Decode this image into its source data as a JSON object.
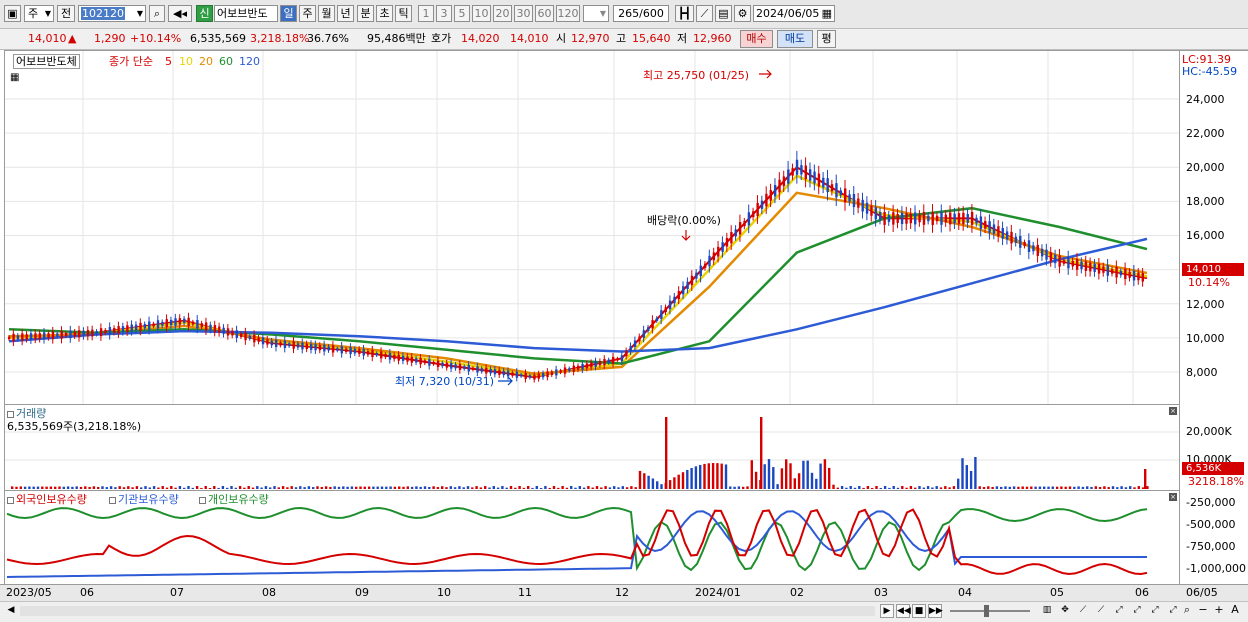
{
  "toolbar": {
    "market": "주",
    "period_prefix": "전",
    "code": "102120",
    "new_badge": "신",
    "stock_name": "어보브반도",
    "period_buttons": [
      "일",
      "주",
      "월",
      "년",
      "분",
      "초",
      "틱"
    ],
    "minute_buttons": [
      "1",
      "3",
      "5",
      "10",
      "20",
      "30",
      "60",
      "120"
    ],
    "count_value": "265",
    "count_total": "/600",
    "date": "2024/06/05"
  },
  "infobar": {
    "price": "14,010",
    "up_arrow": "▲",
    "change": "1,290",
    "change_pct": "+10.14%",
    "volume": "6,535,569",
    "volume_pct": "3,218.18%",
    "turnover": "36.76%",
    "amount": "95,486백만",
    "ask_label": "호가",
    "ask": "14,020",
    "bid": "14,010",
    "open_label": "시",
    "open": "12,970",
    "high_label": "고",
    "high": "15,640",
    "low_label": "저",
    "low": "12,960",
    "buy_label": "매수",
    "sell_label": "매도",
    "eval_label": "평"
  },
  "price_panel": {
    "title": "어보브반도체",
    "legend_prefix": "종가 단순",
    "ma_labels": [
      "5",
      "10",
      "20",
      "60",
      "120"
    ],
    "ma_colors": [
      "#d40000",
      "#e8d400",
      "#e48a00",
      "#1f8f2e",
      "#2d5bd6"
    ],
    "high_annotation": "최고 25,750 (01/25)",
    "low_annotation": "최저 7,320 (10/31)",
    "dividend_annotation": "배당락(0.00%)"
  },
  "price_axis": {
    "lc": "LC:91.39",
    "hc": "HC:-45.59",
    "labels": [
      "24,000",
      "22,000",
      "20,000",
      "18,000",
      "16,000",
      "14,000",
      "12,000",
      "10,000",
      "8,000"
    ],
    "current_price": "14,010",
    "current_pct": "10.14%"
  },
  "volume_panel": {
    "title": "거래량",
    "value": "6,535,569주(3,218.18%)",
    "labels": [
      "20,000K",
      "10,000K"
    ],
    "current": "6,536K",
    "current_pct": "3218.18%"
  },
  "holdings_panel": {
    "legend": [
      "외국인보유수량",
      "기관보유수량",
      "개인보유수량"
    ],
    "legend_colors": [
      "#d40000",
      "#2d5bd6",
      "#1f8f2e"
    ],
    "labels": [
      "-250,000",
      "-500,000",
      "-750,000",
      "-1,000,000"
    ]
  },
  "dates": [
    "2023/05",
    "06",
    "07",
    "08",
    "09",
    "10",
    "11",
    "12",
    "2024/01",
    "02",
    "03",
    "04",
    "05",
    "06",
    "06/05"
  ],
  "chart_data": {
    "type": "line",
    "title": "",
    "xlabel": "",
    "ylabel": "",
    "x": [
      "2023/05",
      "06",
      "07",
      "08",
      "09",
      "10",
      "11",
      "12",
      "2024/01",
      "02",
      "03",
      "04",
      "05",
      "06"
    ],
    "ylim": [
      7000,
      26000
    ],
    "series": [
      {
        "name": "5",
        "values": [
          10000,
          10300,
          11000,
          9700,
          9200,
          8400,
          7700,
          8800,
          14500,
          20000,
          17000,
          17000,
          14500,
          13500
        ]
      },
      {
        "name": "10",
        "values": [
          10000,
          10250,
          10900,
          9800,
          9300,
          8600,
          7800,
          8500,
          14000,
          19500,
          17200,
          16800,
          14600,
          13600
        ]
      },
      {
        "name": "20",
        "values": [
          10100,
          10200,
          10700,
          9900,
          9400,
          8800,
          7900,
          8300,
          13000,
          18500,
          17600,
          16500,
          14800,
          13800
        ]
      },
      {
        "name": "60",
        "values": [
          10500,
          10300,
          10500,
          10200,
          9800,
          9300,
          8800,
          8500,
          9800,
          15000,
          17000,
          17600,
          16500,
          15200
        ]
      },
      {
        "name": "120",
        "values": [
          9800,
          10200,
          10400,
          10300,
          10100,
          9800,
          9400,
          9200,
          9400,
          10500,
          11800,
          13200,
          14600,
          15800
        ]
      }
    ]
  }
}
